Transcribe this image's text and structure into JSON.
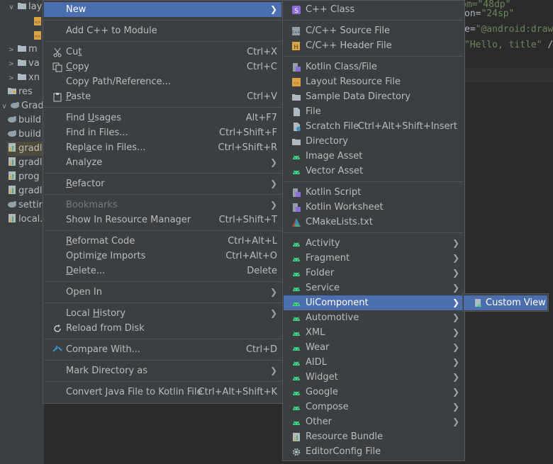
{
  "tree": {
    "items": [
      {
        "label": "lay",
        "chev": "∨",
        "icon": "folder-icon"
      },
      {
        "label": "",
        "chev": "",
        "icon": "xml-file-icon"
      },
      {
        "label": "",
        "chev": "",
        "icon": "xml-file-icon"
      },
      {
        "label": "m",
        "chev": ">",
        "icon": "folder-icon"
      },
      {
        "label": "va",
        "chev": ">",
        "icon": "folder-icon"
      },
      {
        "label": "xn",
        "chev": ">",
        "icon": "folder-icon"
      },
      {
        "label": "res",
        "chev": "",
        "icon": "resources-folder-icon"
      },
      {
        "label": "Gradle S",
        "chev": "∨",
        "icon": "gradle-icon"
      },
      {
        "label": "build",
        "chev": "",
        "icon": "gradle-icon"
      },
      {
        "label": "build",
        "chev": "",
        "icon": "gradle-icon"
      },
      {
        "label": "gradl",
        "chev": "",
        "icon": "properties-file-icon"
      },
      {
        "label": "gradl",
        "chev": "",
        "icon": "properties-file-icon"
      },
      {
        "label": "prog",
        "chev": "",
        "icon": "properties-file-icon"
      },
      {
        "label": "gradl",
        "chev": "",
        "icon": "properties-file-icon"
      },
      {
        "label": "settin",
        "chev": "",
        "icon": "gradle-icon"
      },
      {
        "label": "local.",
        "chev": "",
        "icon": "properties-file-icon"
      }
    ]
  },
  "editor": {
    "line1": "om=\"48dp\"",
    "line2_a": "on=",
    "line2_b": "\"24sp\"",
    "line3_a": "e=",
    "line3_b": "\"@android:draw",
    "line4_a": "\"Hello, title\"",
    "line4_b": " /"
  },
  "context_menu": {
    "items": [
      {
        "label": "New",
        "shortcut": "",
        "submenu": true,
        "selected": true
      },
      {
        "sep": true
      },
      {
        "label": "Add C++ to Module",
        "shortcut": ""
      },
      {
        "sep": true
      },
      {
        "label": "Cut",
        "u": "t",
        "shortcut": "Ctrl+X",
        "icon": "cut-icon"
      },
      {
        "label": "Copy",
        "u": "C",
        "shortcut": "Ctrl+C",
        "icon": "copy-icon"
      },
      {
        "label": "Copy Path/Reference...",
        "shortcut": ""
      },
      {
        "label": "Paste",
        "u": "P",
        "shortcut": "Ctrl+V",
        "icon": "paste-icon"
      },
      {
        "sep": true
      },
      {
        "label": "Find Usages",
        "u": "U",
        "shortcut": "Alt+F7"
      },
      {
        "label": "Find in Files...",
        "shortcut": "Ctrl+Shift+F"
      },
      {
        "label": "Replace in Files...",
        "u": "a",
        "shortcut": "Ctrl+Shift+R"
      },
      {
        "label": "Analyze",
        "submenu": true
      },
      {
        "sep": true
      },
      {
        "label": "Refactor",
        "u": "R",
        "submenu": true
      },
      {
        "sep": true
      },
      {
        "label": "Bookmarks",
        "submenu": true,
        "disabled": true
      },
      {
        "label": "Show In Resource Manager",
        "shortcut": "Ctrl+Shift+T"
      },
      {
        "sep": true
      },
      {
        "label": "Reformat Code",
        "u": "R",
        "shortcut": "Ctrl+Alt+L"
      },
      {
        "label": "Optimize Imports",
        "u": "z",
        "shortcut": "Ctrl+Alt+O"
      },
      {
        "label": "Delete...",
        "u": "D",
        "shortcut": "Delete"
      },
      {
        "sep": true
      },
      {
        "label": "Open In",
        "submenu": true
      },
      {
        "sep": true
      },
      {
        "label": "Local History",
        "u": "H",
        "submenu": true
      },
      {
        "label": "Reload from Disk",
        "shortcut": "",
        "icon": "reload-icon"
      },
      {
        "sep": true
      },
      {
        "label": "Compare With...",
        "shortcut": "Ctrl+D",
        "icon": "compare-icon"
      },
      {
        "sep": true
      },
      {
        "label": "Mark Directory as",
        "submenu": true
      },
      {
        "sep": true
      },
      {
        "label": "Convert Java File to Kotlin File",
        "shortcut": "Ctrl+Alt+Shift+K"
      }
    ]
  },
  "new_submenu": {
    "items": [
      {
        "label": "C++ Class",
        "icon": "cpp-class-icon"
      },
      {
        "sep": true
      },
      {
        "label": "C/C++ Source File",
        "icon": "cpp-source-icon"
      },
      {
        "label": "C/C++ Header File",
        "icon": "cpp-header-icon"
      },
      {
        "sep": true
      },
      {
        "label": "Kotlin Class/File",
        "icon": "kotlin-icon"
      },
      {
        "label": "Layout Resource File",
        "icon": "layout-file-icon"
      },
      {
        "label": "Sample Data Directory",
        "icon": "folder-icon"
      },
      {
        "label": "File",
        "icon": "file-icon"
      },
      {
        "label": "Scratch File",
        "shortcut": "Ctrl+Alt+Shift+Insert",
        "icon": "scratch-file-icon"
      },
      {
        "label": "Directory",
        "icon": "folder-icon"
      },
      {
        "label": "Image Asset",
        "icon": "android-icon"
      },
      {
        "label": "Vector Asset",
        "icon": "android-icon"
      },
      {
        "sep": true
      },
      {
        "label": "Kotlin Script",
        "icon": "kotlin-icon"
      },
      {
        "label": "Kotlin Worksheet",
        "icon": "kotlin-icon"
      },
      {
        "label": "CMakeLists.txt",
        "icon": "cmake-icon"
      },
      {
        "sep": true
      },
      {
        "label": "Activity",
        "icon": "android-icon",
        "submenu": true
      },
      {
        "label": "Fragment",
        "icon": "android-icon",
        "submenu": true
      },
      {
        "label": "Folder",
        "icon": "android-icon",
        "submenu": true
      },
      {
        "label": "Service",
        "icon": "android-icon",
        "submenu": true
      },
      {
        "label": "UiComponent",
        "icon": "android-icon",
        "submenu": true,
        "selected": true
      },
      {
        "label": "Automotive",
        "icon": "android-icon",
        "submenu": true
      },
      {
        "label": "XML",
        "icon": "android-icon",
        "submenu": true
      },
      {
        "label": "Wear",
        "icon": "android-icon",
        "submenu": true
      },
      {
        "label": "AIDL",
        "icon": "android-icon",
        "submenu": true
      },
      {
        "label": "Widget",
        "icon": "android-icon",
        "submenu": true
      },
      {
        "label": "Google",
        "icon": "android-icon",
        "submenu": true
      },
      {
        "label": "Compose",
        "icon": "android-icon",
        "submenu": true
      },
      {
        "label": "Other",
        "icon": "android-icon",
        "submenu": true
      },
      {
        "label": "Resource Bundle",
        "icon": "resource-bundle-icon"
      },
      {
        "label": "EditorConfig File",
        "icon": "gear-icon"
      }
    ]
  },
  "uicomponent_submenu": {
    "items": [
      {
        "label": "Custom View",
        "icon": "custom-view-icon",
        "selected": true
      }
    ]
  },
  "colors": {
    "accent": "#4b6eaf",
    "menu_bg": "#3c3f41",
    "android_green": "#3ddc84",
    "kotlin_purple": "#8f6dd9"
  }
}
